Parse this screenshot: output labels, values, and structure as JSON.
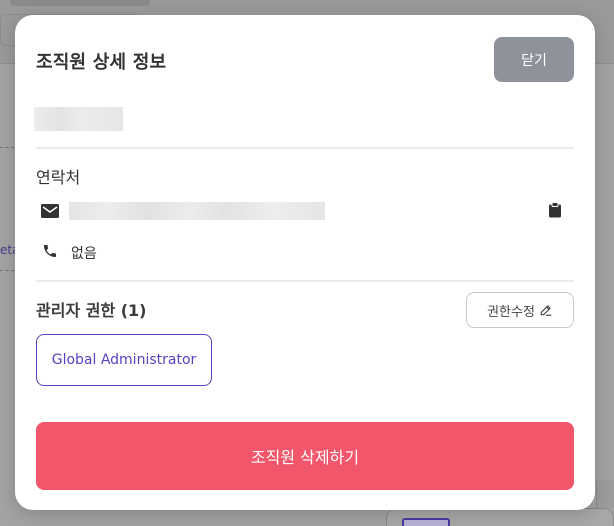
{
  "background": {
    "link_fragment": "eta"
  },
  "modal": {
    "title": "조직원 상세 정보",
    "close_label": "닫기",
    "contact": {
      "section_label": "연락처",
      "phone_value": "없음"
    },
    "roles": {
      "section_label": "관리자 권한 (1)",
      "edit_label": "권한수정",
      "items": [
        "Global Administrator"
      ]
    },
    "delete_label": "조직원 삭제하기"
  },
  "colors": {
    "accent": "#5b3fc4",
    "danger": "#f2566a",
    "close_button": "#8e939b"
  },
  "icons": {
    "email": "mail-icon",
    "phone": "phone-icon",
    "copy": "clipboard-icon",
    "edit": "pencil-icon"
  }
}
